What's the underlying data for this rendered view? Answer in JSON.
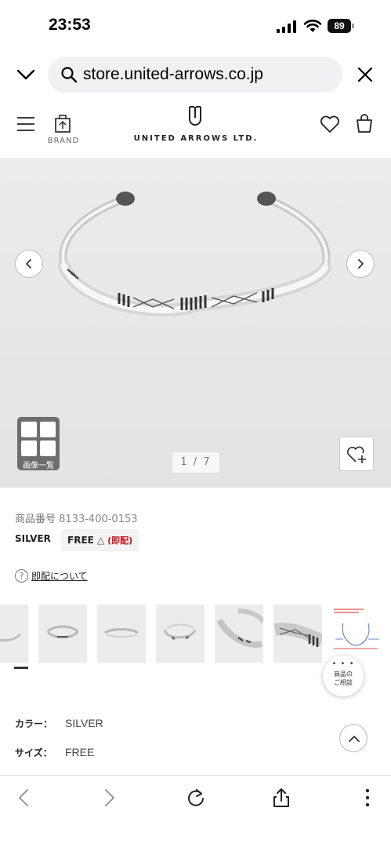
{
  "status_bar": {
    "time": "23:53",
    "battery": "89"
  },
  "browser": {
    "url": "store.united-arrows.co.jp"
  },
  "header": {
    "brand_label": "BRAND",
    "logo_text": "UNITED ARROWS LTD."
  },
  "gallery": {
    "counter": "1 / 7",
    "grid_label": "画像一覧"
  },
  "product": {
    "number_label": "商品番号",
    "number": "8133-400-0153",
    "color": "SILVER",
    "size": "FREE",
    "stock_mark": "△",
    "stock_note": "(即配)",
    "shipping_link": "即配について",
    "consult_dots": "• • •",
    "consult_line1": "商品の",
    "consult_line2": "ご相談",
    "color_label": "カラー：",
    "color_value": "SILVER",
    "size_label": "サイズ：",
    "size_value": "FREE"
  },
  "icons": [
    "chevron-down-icon",
    "search-icon",
    "close-icon",
    "menu-icon",
    "brand-icon",
    "logo-mark-icon",
    "heart-icon",
    "bag-icon",
    "arrow-left-icon",
    "arrow-right-icon",
    "grid-icon",
    "heart-plus-icon",
    "question-icon",
    "chevron-up-icon",
    "back-icon",
    "forward-icon",
    "reload-icon",
    "share-icon",
    "more-icon"
  ]
}
